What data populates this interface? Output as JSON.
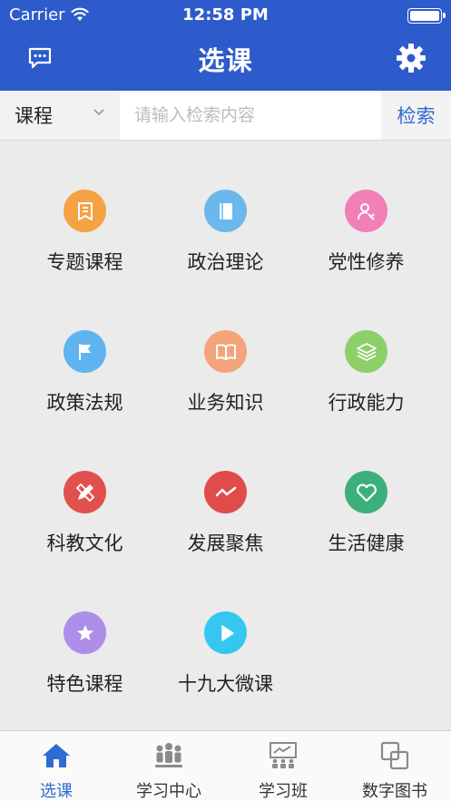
{
  "status_bar": {
    "carrier": "Carrier",
    "time": "12:58 PM"
  },
  "nav": {
    "title": "选课",
    "left_icon": "message-icon",
    "right_icon": "gear-icon"
  },
  "search": {
    "category": "课程",
    "placeholder": "请输入检索内容",
    "button": "检索"
  },
  "categories": [
    {
      "label": "专题课程",
      "icon": "bookmark-icon",
      "color": "#f5a243"
    },
    {
      "label": "政治理论",
      "icon": "book-icon",
      "color": "#6cb8ec"
    },
    {
      "label": "党性修养",
      "icon": "party-user-icon",
      "color": "#f17fb8"
    },
    {
      "label": "政策法规",
      "icon": "flag-icon",
      "color": "#5fb4f0"
    },
    {
      "label": "业务知识",
      "icon": "open-book-icon",
      "color": "#f4a47a"
    },
    {
      "label": "行政能力",
      "icon": "layers-icon",
      "color": "#8dcf68"
    },
    {
      "label": "科教文化",
      "icon": "pencil-ruler-icon",
      "color": "#e2504d"
    },
    {
      "label": "发展聚焦",
      "icon": "trend-icon",
      "color": "#e04b4b"
    },
    {
      "label": "生活健康",
      "icon": "heart-icon",
      "color": "#3cb07a"
    },
    {
      "label": "特色课程",
      "icon": "star-icon",
      "color": "#ad8ee8"
    },
    {
      "label": "十九大微课",
      "icon": "play-icon",
      "color": "#35c7f0"
    }
  ],
  "tabs": [
    {
      "label": "选课",
      "icon": "home-icon",
      "active": true
    },
    {
      "label": "学习中心",
      "icon": "people-icon",
      "active": false
    },
    {
      "label": "学习班",
      "icon": "classroom-icon",
      "active": false
    },
    {
      "label": "数字图书",
      "icon": "copy-icon",
      "active": false
    }
  ]
}
